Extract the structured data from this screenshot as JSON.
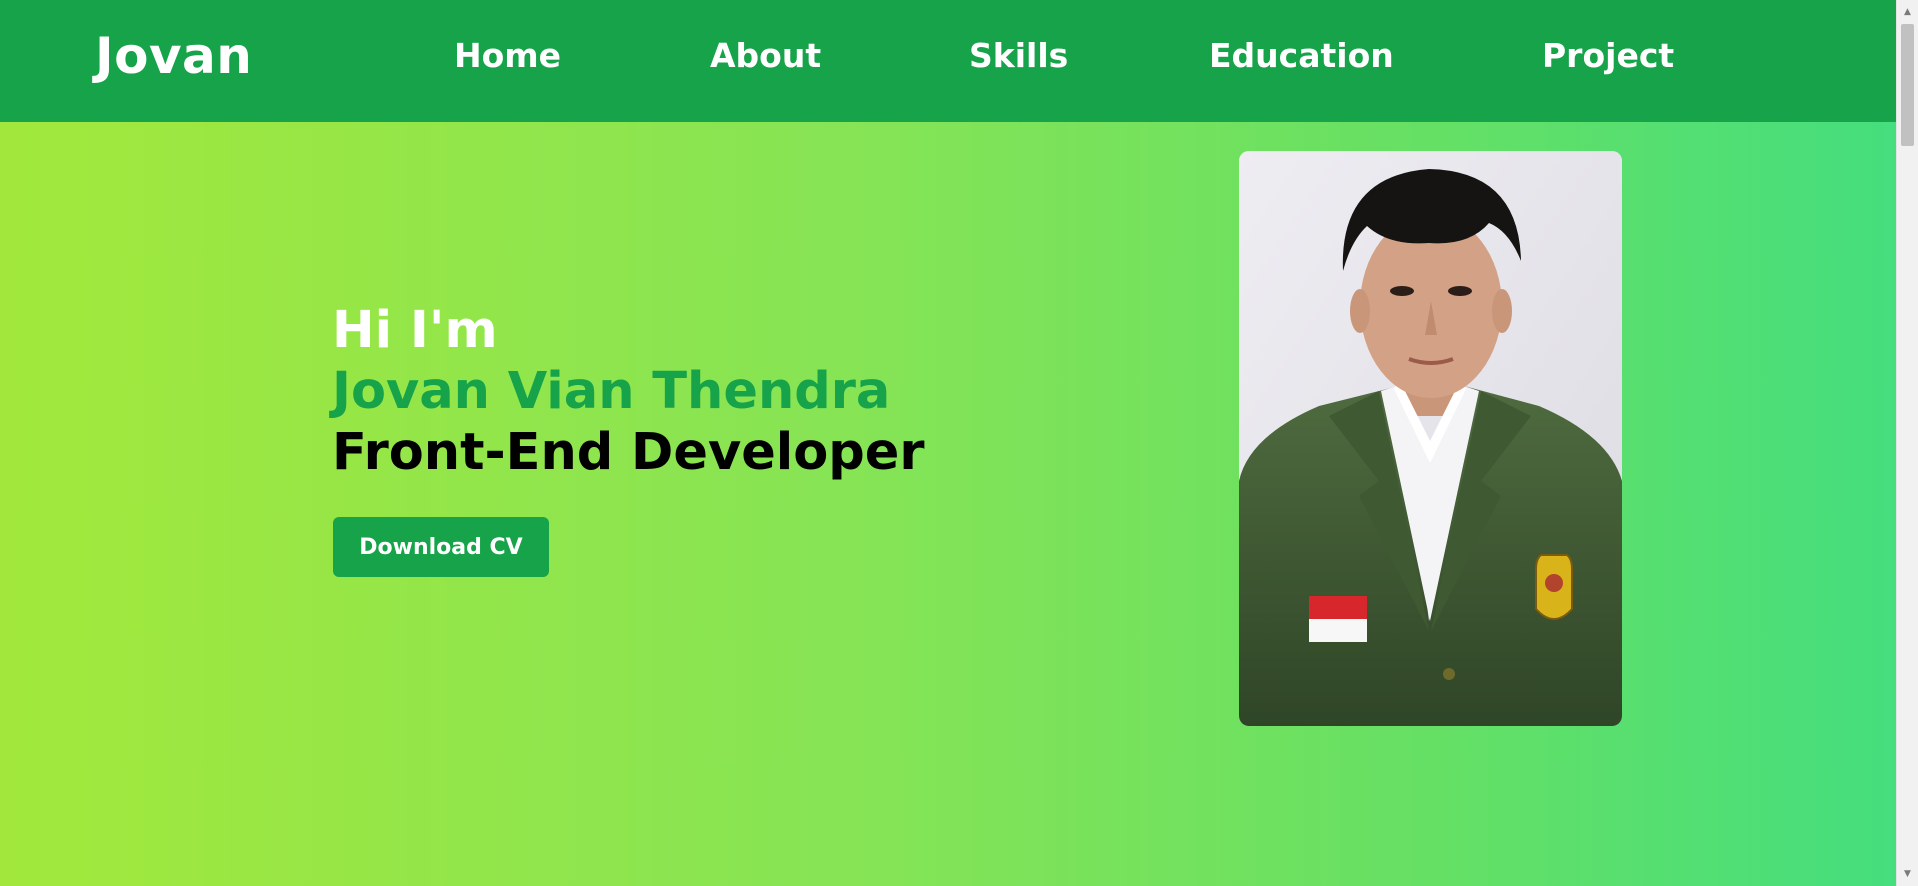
{
  "header": {
    "logo": "Jovan",
    "nav": [
      {
        "label": "Home"
      },
      {
        "label": "About"
      },
      {
        "label": "Skills"
      },
      {
        "label": "Education"
      },
      {
        "label": "Project"
      }
    ]
  },
  "hero": {
    "greeting": "Hi I'm",
    "name": "Jovan Vian Thendra",
    "role": "Front-End Developer",
    "cta_label": "Download CV"
  },
  "colors": {
    "header_bg": "#17a34a",
    "accent": "#16a34a",
    "gradient_start": "#a2e83c",
    "gradient_end": "#45de7e"
  }
}
